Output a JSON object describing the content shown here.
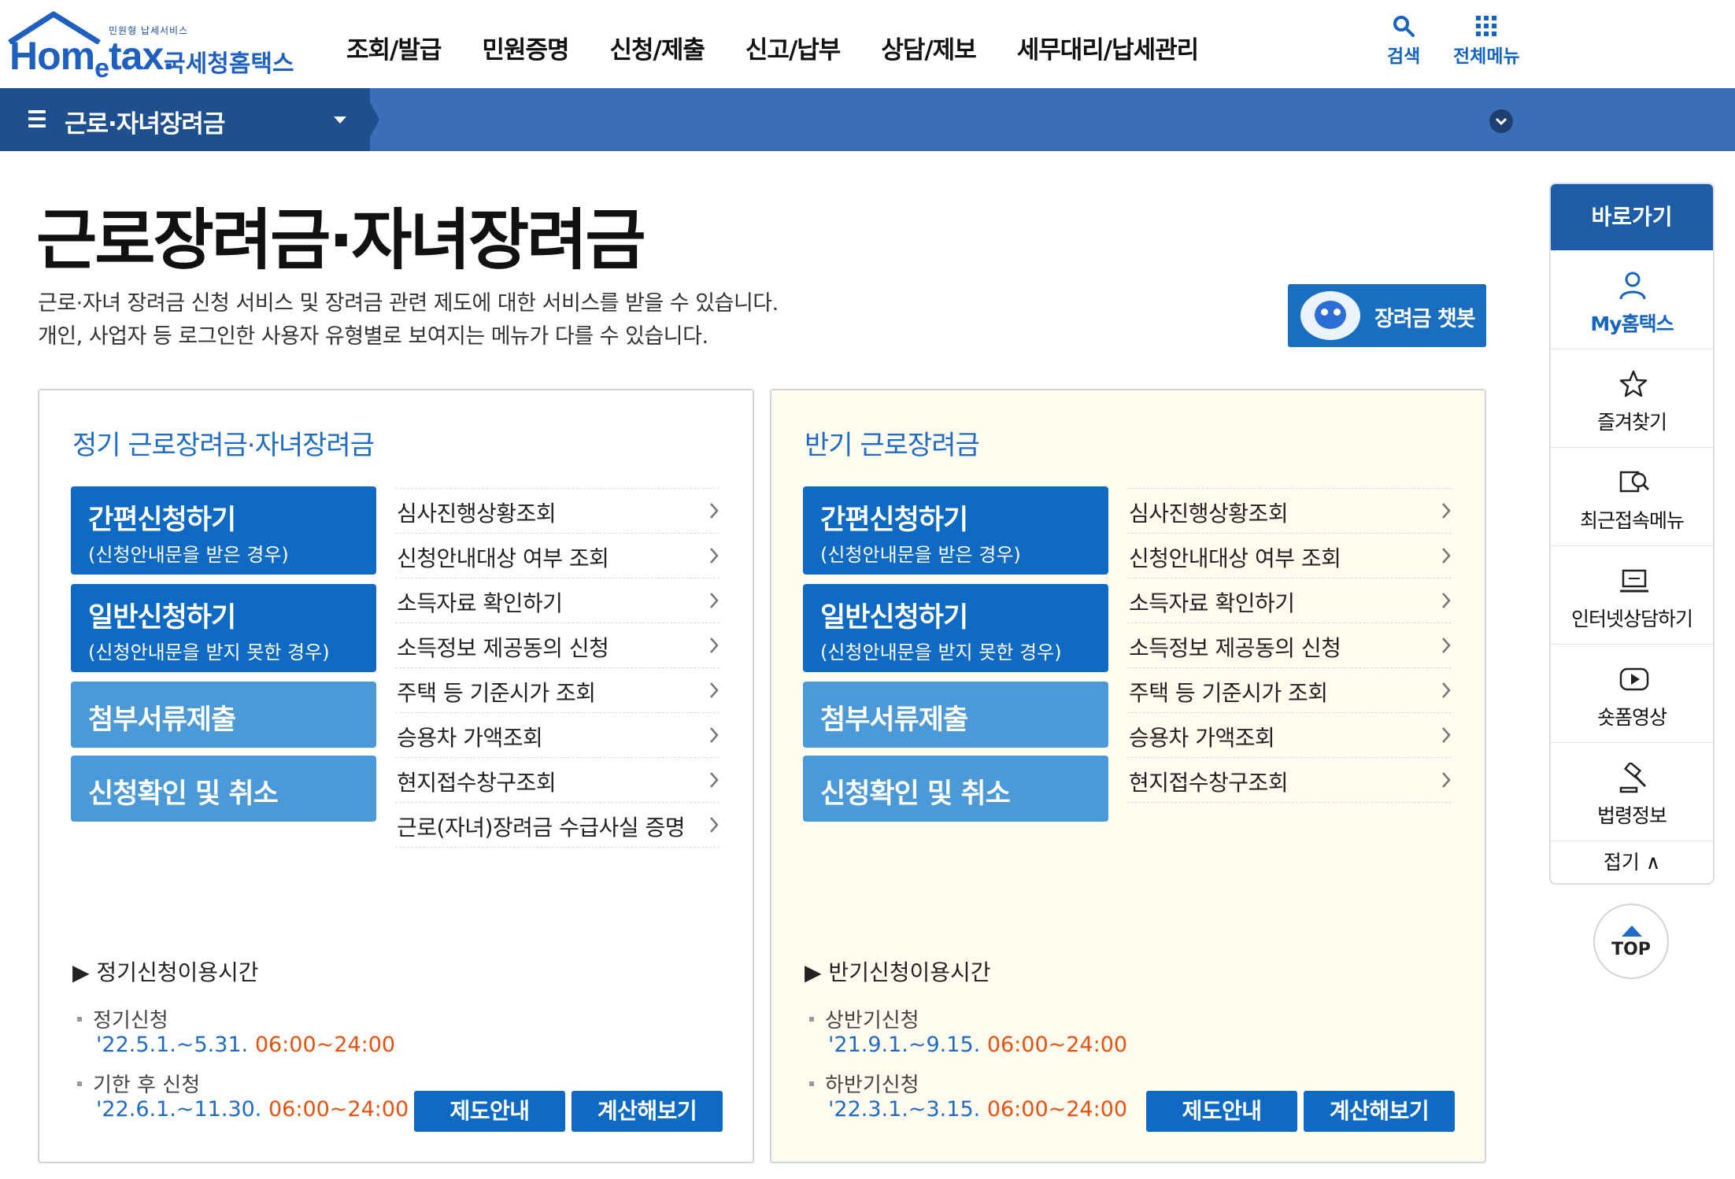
{
  "header": {
    "logo_small": "민원형 납세서비스",
    "logo_main_1": "Hom",
    "logo_main_e": "e",
    "logo_main_2": "tax.",
    "logo_korean": "국세청홈택스",
    "nav": [
      "조회/발급",
      "민원증명",
      "신청/제출",
      "신고/납부",
      "상담/제보",
      "세무대리/납세관리"
    ],
    "search_label": "검색",
    "all_menu_label": "전체메뉴"
  },
  "subbar": {
    "title": "근로·자녀장려금"
  },
  "page": {
    "title": "근로장려금·자녀장려금",
    "desc_line1": "근로·자녀 장려금 신청 서비스 및 장려금 관련 제도에 대한 서비스를 받을 수 있습니다.",
    "desc_line2": "개인, 사업자 등 로그인한 사용자 유형별로 보여지는 메뉴가 다를 수 있습니다.",
    "chatbot_label": "장려금 챗봇"
  },
  "panel_regular": {
    "title": "정기 근로장려금·자녀장려금",
    "btn_simple": "간편신청하기",
    "btn_simple_sub": "(신청안내문을 받은 경우)",
    "btn_general": "일반신청하기",
    "btn_general_sub": "(신청안내문을 받지 못한 경우)",
    "btn_docs": "첨부서류제출",
    "btn_confirm": "신청확인 및 취소",
    "links": [
      "심사진행상황조회",
      "신청안내대상 여부 조회",
      "소득자료 확인하기",
      "소득정보 제공동의 신청",
      "주택 등 기준시가 조회",
      "승용차 가액조회",
      "현지접수창구조회",
      "근로(자녀)장려금 수급사실 증명"
    ],
    "usage_title": "▶ 정기신청이용시간",
    "usage1_label": "정기신청",
    "usage1_date": "'22.5.1.~5.31.",
    "usage1_time": "06:00~24:00",
    "usage2_label": "기한 후 신청",
    "usage2_date": "'22.6.1.~11.30.",
    "usage2_time": "06:00~24:00",
    "btn_guide": "제도안내",
    "btn_calc": "계산해보기"
  },
  "panel_half": {
    "title": "반기 근로장려금",
    "btn_simple": "간편신청하기",
    "btn_simple_sub": "(신청안내문을 받은 경우)",
    "btn_general": "일반신청하기",
    "btn_general_sub": "(신청안내문을 받지 못한 경우)",
    "btn_docs": "첨부서류제출",
    "btn_confirm": "신청확인 및 취소",
    "links": [
      "심사진행상황조회",
      "신청안내대상 여부 조회",
      "소득자료 확인하기",
      "소득정보 제공동의 신청",
      "주택 등 기준시가 조회",
      "승용차 가액조회",
      "현지접수창구조회"
    ],
    "usage_title": "▶ 반기신청이용시간",
    "usage1_label": "상반기신청",
    "usage1_date": "'21.9.1.~9.15.",
    "usage1_time": "06:00~24:00",
    "usage2_label": "하반기신청",
    "usage2_date": "'22.3.1.~3.15.",
    "usage2_time": "06:00~24:00",
    "btn_guide": "제도안내",
    "btn_calc": "계산해보기"
  },
  "quick": {
    "title": "바로가기",
    "items": [
      {
        "label": "My홈택스",
        "icon": "user-icon"
      },
      {
        "label": "즐겨찾기",
        "icon": "star-icon"
      },
      {
        "label": "최근접속메뉴",
        "icon": "recent-search-icon"
      },
      {
        "label": "인터넷상담하기",
        "icon": "laptop-chat-icon"
      },
      {
        "label": "숏폼영상",
        "icon": "play-icon"
      },
      {
        "label": "법령정보",
        "icon": "gavel-icon"
      }
    ],
    "fold_label": "접기 ∧",
    "top_label": "TOP"
  },
  "colors": {
    "brand_blue": "#0e6ac2",
    "light_blue": "#4b9ad7",
    "subbar": "#3a6fb7",
    "time_orange": "#e8510f",
    "panel2_bg": "#fffcef"
  }
}
